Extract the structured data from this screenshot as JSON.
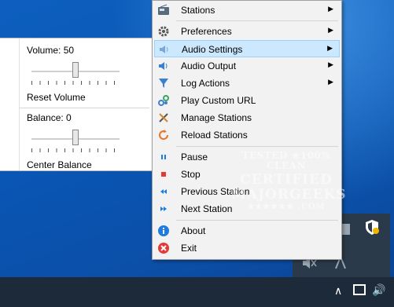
{
  "volume_panel": {
    "volume_label": "Volume: 50",
    "volume_level": 50,
    "reset_volume": "Reset Volume",
    "balance_label": "Balance: 0",
    "balance_level": 0,
    "center_balance": "Center Balance"
  },
  "menu": {
    "items": [
      {
        "label": "Stations",
        "icon": "radio-icon",
        "submenu": true
      },
      {
        "label": "Preferences",
        "icon": "gear-icon",
        "submenu": true
      },
      {
        "label": "Audio Settings",
        "icon": "audio-settings-icon",
        "submenu": true,
        "selected": true
      },
      {
        "label": "Audio Output",
        "icon": "speaker-icon",
        "submenu": true
      },
      {
        "label": "Log Actions",
        "icon": "log-icon",
        "submenu": true
      },
      {
        "label": "Play Custom URL",
        "icon": "link-icon",
        "submenu": false
      },
      {
        "label": "Manage Stations",
        "icon": "tools-icon",
        "submenu": false
      },
      {
        "label": "Reload Stations",
        "icon": "reload-icon",
        "submenu": false
      },
      {
        "label": "Pause",
        "icon": "pause-icon",
        "submenu": false
      },
      {
        "label": "Stop",
        "icon": "stop-icon",
        "submenu": false
      },
      {
        "label": "Previous Station",
        "icon": "previous-icon",
        "submenu": false
      },
      {
        "label": "Next Station",
        "icon": "next-icon",
        "submenu": false
      },
      {
        "label": "About",
        "icon": "info-icon",
        "submenu": false
      },
      {
        "label": "Exit",
        "icon": "exit-icon",
        "submenu": false
      }
    ]
  },
  "watermark": {
    "line1": "TESTED ★100% CLEAN",
    "line2": "CERTIFIED",
    "line3": "MAJORGEEKS",
    "line4": "★★★★★★ .COM"
  },
  "colors": {
    "desktop": "#0b56b4",
    "taskbar": "#1c2a3a",
    "menu_bg": "#f2f2f2",
    "selection": "#cce8ff",
    "stop_red": "#e53935",
    "accent_blue": "#1e7be0"
  }
}
